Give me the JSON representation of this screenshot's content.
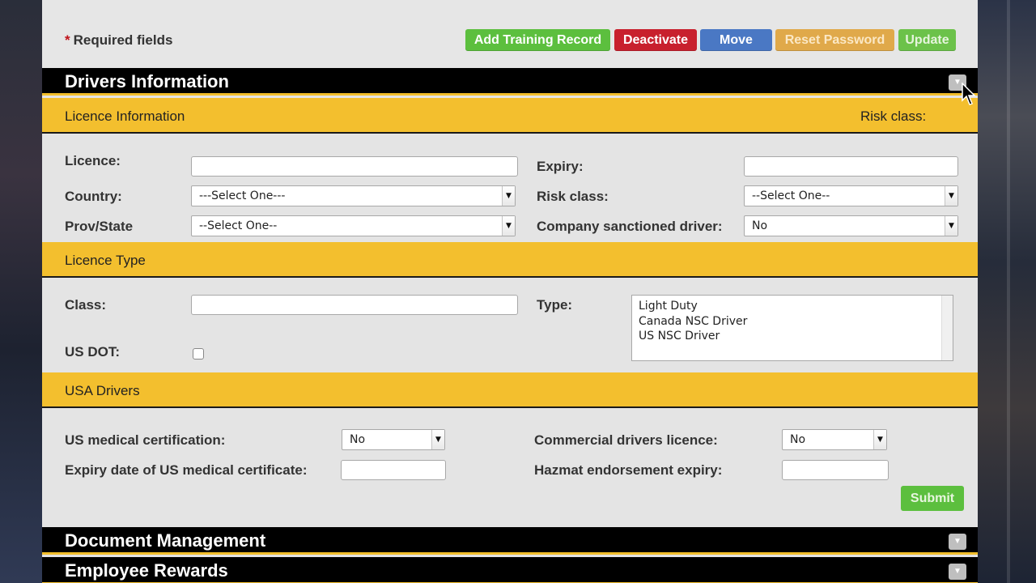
{
  "header": {
    "required_star": "*",
    "required_text": "Required fields"
  },
  "toolbar": {
    "add_training_label": "Add Training Record",
    "deactivate_label": "Deactivate",
    "move_label": "Move",
    "reset_password_label": "Reset Password",
    "update_label": "Update"
  },
  "drivers_section": {
    "title": "Drivers Information",
    "licence_info": {
      "heading": "Licence Information",
      "risk_heading": "Risk class:",
      "licence_label": "Licence:",
      "licence_value": "",
      "expiry_label": "Expiry:",
      "expiry_value": "",
      "country_label": "Country:",
      "country_value": "---Select One---",
      "risk_label": "Risk class:",
      "risk_value": "--Select One--",
      "prov_label": "Prov/State",
      "prov_value": "--Select One--",
      "sanctioned_label": "Company sanctioned driver:",
      "sanctioned_value": "No"
    },
    "licence_type": {
      "heading": "Licence Type",
      "class_label": "Class:",
      "class_value": "",
      "type_label": "Type:",
      "type_options": [
        "Light Duty",
        "Canada NSC Driver",
        "US NSC Driver"
      ],
      "usdot_label": "US DOT:",
      "usdot_checked": false
    },
    "usa_drivers": {
      "heading": "USA Drivers",
      "medcert_label": "US medical certification:",
      "medcert_value": "No",
      "cdl_label": "Commercial drivers licence:",
      "cdl_value": "No",
      "med_expiry_label": "Expiry date of US medical certificate:",
      "med_expiry_value": "",
      "hazmat_label": "Hazmat endorsement expiry:",
      "hazmat_value": "",
      "submit_label": "Submit"
    }
  },
  "collapsed_sections": {
    "document_management": "Document Management",
    "employee_rewards": "Employee Rewards"
  },
  "icons": {
    "toggle": "chevron-down-icon",
    "select_arrow": "dropdown-arrow-icon"
  },
  "colors": {
    "accent_yellow": "#f3bf2e",
    "green": "#5cbf3e",
    "red": "#c8202d",
    "blue": "#4a78c4",
    "orange": "#e0a94a"
  }
}
